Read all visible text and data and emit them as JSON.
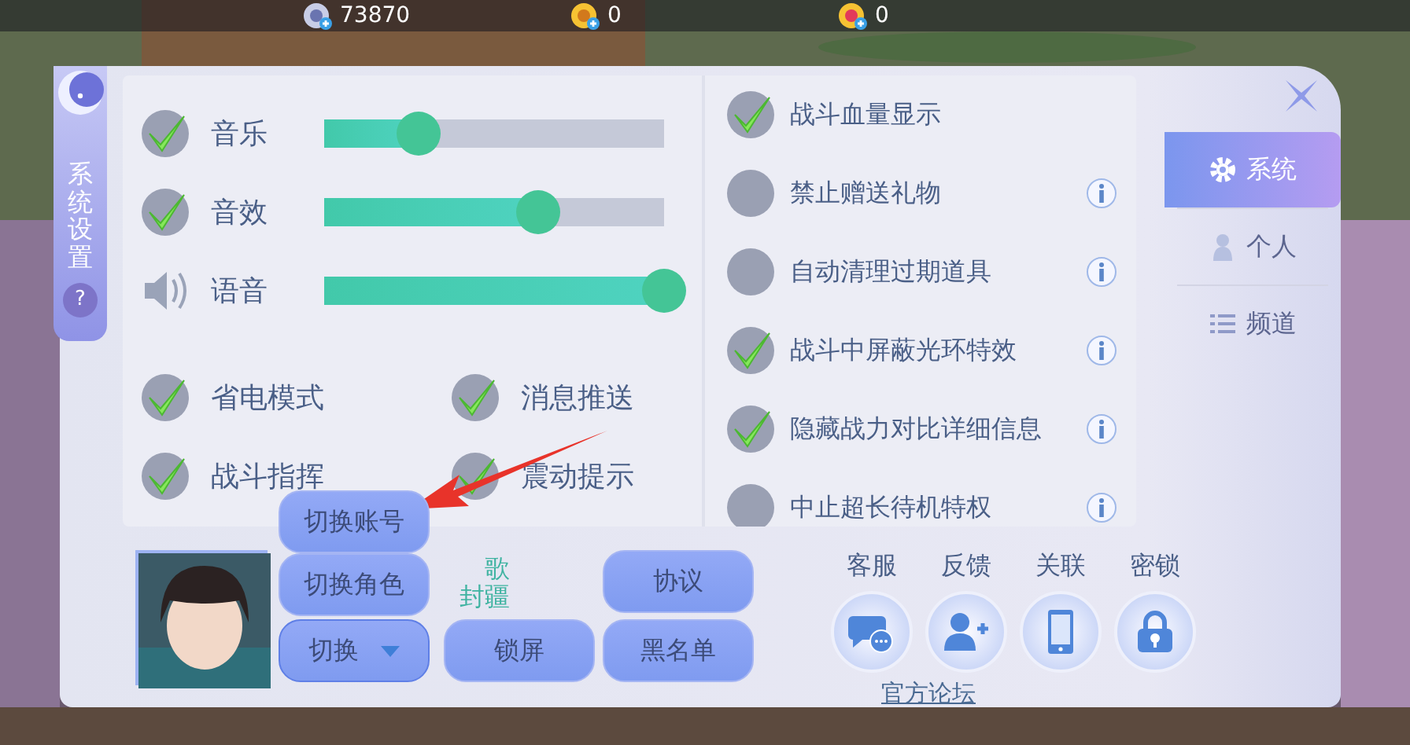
{
  "currencies": [
    {
      "kind": "silver",
      "value": "73870"
    },
    {
      "kind": "gold",
      "value": "0"
    },
    {
      "kind": "heart",
      "value": "0"
    }
  ],
  "side_tab": {
    "label": "系统设置",
    "help": "?"
  },
  "volume": [
    {
      "kind": "check",
      "label": "音乐",
      "checked": true,
      "level": 0.28
    },
    {
      "kind": "check",
      "label": "音效",
      "checked": true,
      "level": 0.63
    },
    {
      "kind": "speaker",
      "label": "语音",
      "level": 1.0
    }
  ],
  "toggles": [
    {
      "label": "省电模式",
      "checked": true
    },
    {
      "label": "消息推送",
      "checked": true
    },
    {
      "label": "战斗指挥",
      "checked": true
    },
    {
      "label": "震动提示",
      "checked": true
    }
  ],
  "options": [
    {
      "label": "战斗血量显示",
      "checked": true,
      "info": false
    },
    {
      "label": "禁止赠送礼物",
      "checked": false,
      "info": true
    },
    {
      "label": "自动清理过期道具",
      "checked": false,
      "info": true
    },
    {
      "label": "战斗中屏蔽光环特效",
      "checked": true,
      "info": true
    },
    {
      "label": "隐藏战力对比详细信息",
      "checked": true,
      "info": true
    },
    {
      "label": "中止超长待机特权",
      "checked": false,
      "info": true
    }
  ],
  "nav": [
    {
      "kind": "gear",
      "label": "系统",
      "selected": true
    },
    {
      "kind": "person",
      "label": "个人",
      "selected": false
    },
    {
      "kind": "list",
      "label": "频道",
      "selected": false
    }
  ],
  "profile": {
    "name_fragment": "歌",
    "server_fragment": "封疆"
  },
  "switch_menu": {
    "label": "切换",
    "expanded": true,
    "items": [
      "切换账号",
      "切换角色"
    ]
  },
  "buttons": [
    {
      "label": "锁屏"
    },
    {
      "label": "协议"
    },
    {
      "label": "黑名单"
    }
  ],
  "services": [
    {
      "kind": "chat",
      "label": "客服"
    },
    {
      "kind": "person_add",
      "label": "反馈"
    },
    {
      "kind": "phone",
      "label": "关联"
    },
    {
      "kind": "lock",
      "label": "密锁"
    }
  ],
  "forum_link": "官方论坛"
}
